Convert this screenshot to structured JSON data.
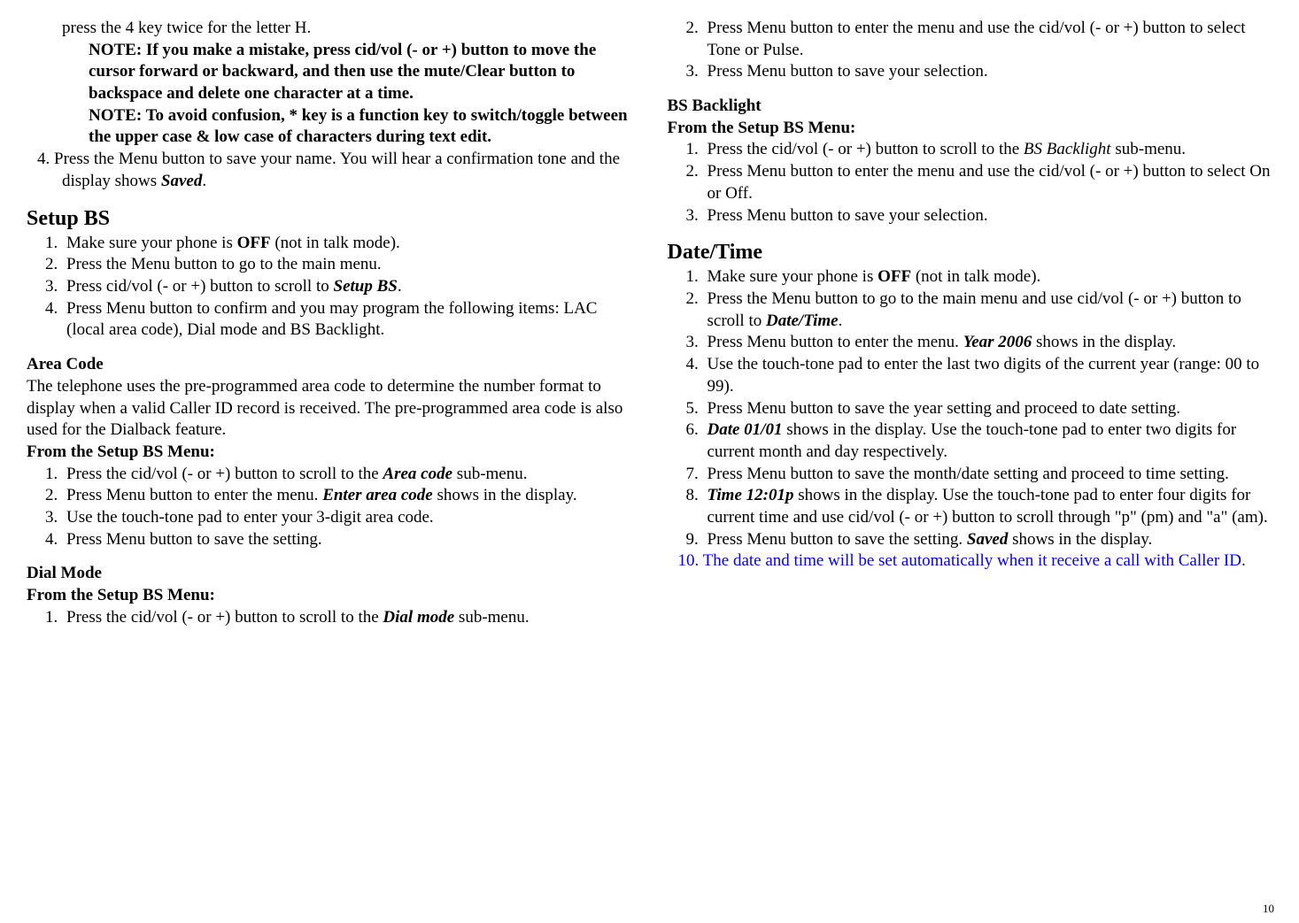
{
  "left": {
    "line1": "press the 4 key twice for the letter H.",
    "note1": "NOTE: If you make a mistake, press cid/vol (- or +) button to move the cursor forward or backward, and then use the mute/Clear button to backspace and delete one character at a time.",
    "note2": "NOTE: To avoid confusion, * key is a function key to switch/toggle between the upper case & low case of characters during text edit.",
    "step4a": "4. ",
    "step4b": "Press the Menu button to save your name. You will hear a confirmation tone and the display shows ",
    "step4c": "Saved",
    "step4d": ".",
    "setupbs_title": "Setup BS",
    "setupbs_1a": "Make sure your phone is ",
    "setupbs_1b": "OFF",
    "setupbs_1c": " (not in talk mode).",
    "setupbs_2": "Press the Menu button to go to the main menu.",
    "setupbs_3a": "Press cid/vol (- or +) button to scroll to ",
    "setupbs_3b": "Setup BS",
    "setupbs_3c": ".",
    "setupbs_4": "Press Menu button to confirm and you may program the following items: LAC (local area code), Dial mode and BS Backlight.",
    "areacode_title": "Area Code",
    "areacode_intro": "The telephone uses the pre-programmed area code to determine the number format to display when a valid Caller ID record is received. The pre-programmed area code is also used for the Dialback feature.",
    "from_setup": "From the Setup BS Menu:",
    "areacode_1a": "Press the cid/vol (- or +) button to scroll to the ",
    "areacode_1b": "Area code",
    "areacode_1c": " sub-menu.",
    "areacode_2a": "Press Menu button to enter the menu. ",
    "areacode_2b": "Enter area code",
    "areacode_2c": " shows in the display.",
    "areacode_3": "Use the touch-tone pad to enter your 3-digit area code.",
    "areacode_4": "Press Menu button to save the setting.",
    "dialmode_title": "Dial Mode",
    "dialmode_1a": "Press the cid/vol (- or +) button to scroll to the ",
    "dialmode_1b": "Dial mode",
    "dialmode_1c": " sub-menu."
  },
  "right": {
    "dialmode_2": "Press Menu button to enter the menu and use the cid/vol (- or +) button to select Tone or Pulse.",
    "dialmode_3": "Press Menu button to save your selection.",
    "bsback_title": "BS Backlight",
    "from_setup": "From the Setup BS Menu:",
    "bsback_1a": "Press the cid/vol (- or +) button to scroll to the ",
    "bsback_1b": "BS Backlight",
    "bsback_1c": " sub-menu.",
    "bsback_2": "Press Menu button to enter the menu and use the cid/vol (- or +) button to select On or Off.",
    "bsback_3": "Press Menu button to save your selection.",
    "datetime_title": "Date/Time",
    "dt_1a": "Make sure your phone is ",
    "dt_1b": "OFF",
    "dt_1c": " (not in talk mode).",
    "dt_2a": "Press the Menu button to go to the main menu and use cid/vol (- or +) button to scroll to ",
    "dt_2b": "Date/Time",
    "dt_2c": ".",
    "dt_3a": "Press Menu button to enter the menu. ",
    "dt_3b": "Year 2006",
    "dt_3c": " shows in the display.",
    "dt_4": "Use the touch-tone pad to enter the last two digits of the current year (range: 00 to 99).",
    "dt_5": "Press Menu button to save the year setting and proceed to date setting.",
    "dt_6a": "Date 01/01",
    "dt_6b": " shows in the display. Use the touch-tone pad to enter two digits for current month and day respectively.",
    "dt_7": "Press Menu button to save the month/date setting and proceed to time setting.",
    "dt_8a": "Time 12:01p",
    "dt_8b": " shows in the display. Use the touch-tone pad to enter four digits for current time and use cid/vol (- or +) button to scroll through \"p\" (pm) and \"a\" (am).",
    "dt_9a": "Press Menu button to save the setting. ",
    "dt_9b": "Saved",
    "dt_9c": " shows in the display.",
    "dt_10": "10. The date and time will be set automatically when it receive a call with Caller ID."
  },
  "page_num": "10"
}
